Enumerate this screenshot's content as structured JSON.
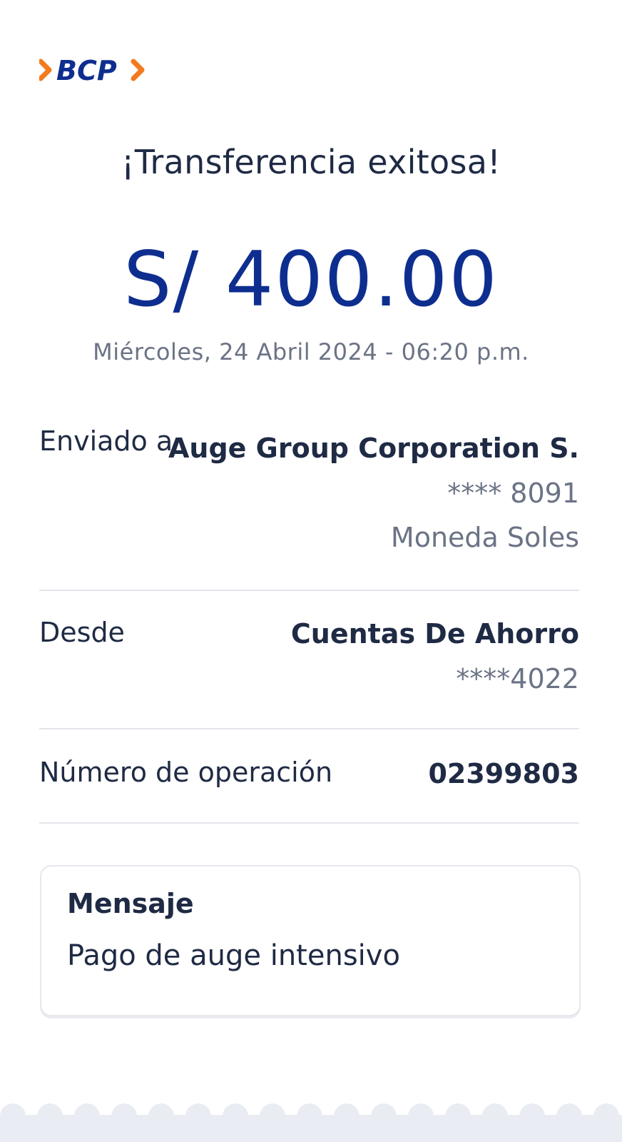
{
  "brand": {
    "logo_text": "BCP",
    "navy": "#0e2e8f",
    "orange": "#f37a1f"
  },
  "receipt": {
    "title": "¡Transferencia exitosa!",
    "amount": "S/ 400.00",
    "datetime": "Miércoles, 24 Abril 2024 - 06:20 p.m."
  },
  "details": {
    "sent_to": {
      "label": "Enviado a",
      "name": "Auge Group Corporation S.",
      "account": "**** 8091",
      "currency": "Moneda Soles"
    },
    "from": {
      "label": "Desde",
      "account_type": "Cuentas De Ahorro",
      "account": "****4022"
    },
    "operation": {
      "label": "Número de operación",
      "number": "02399803"
    }
  },
  "message": {
    "title": "Mensaje",
    "body": "Pago de auge intensivo"
  },
  "colors": {
    "text_dark": "#1f2a44",
    "text_muted": "#6b7385",
    "divider": "#e3e6ec",
    "footer": "#e9ecf3"
  }
}
